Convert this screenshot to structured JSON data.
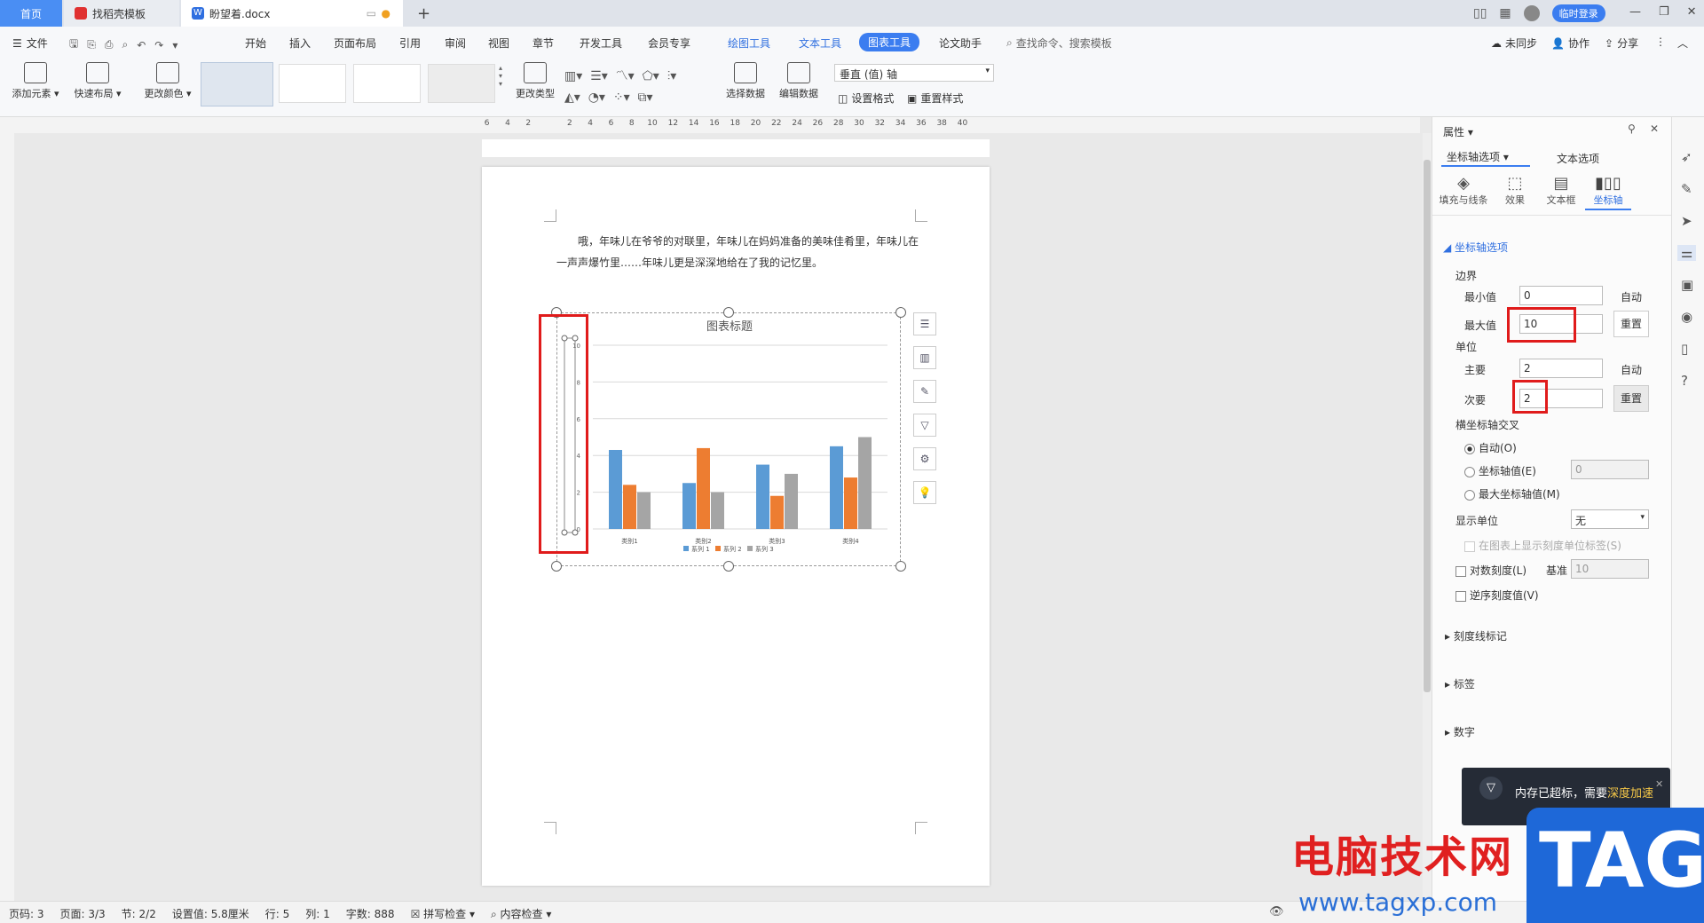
{
  "titlebar": {
    "tabs": [
      {
        "label": "首页"
      },
      {
        "label": "找稻壳模板"
      },
      {
        "label": "盼望着.docx"
      }
    ],
    "login_label": "临时登录"
  },
  "menu": {
    "file_label": "文件",
    "tabs": [
      "开始",
      "插入",
      "页面布局",
      "引用",
      "审阅",
      "视图",
      "章节",
      "开发工具",
      "会员专享",
      "绘图工具",
      "文本工具",
      "图表工具",
      "论文助手"
    ],
    "active_tab": "图表工具",
    "search_placeholder": "查找命令、搜索模板",
    "sync_label": "未同步",
    "collab_label": "协作",
    "share_label": "分享"
  },
  "ribbon": {
    "add_element": "添加元素",
    "quick_layout": "快速布局",
    "change_color": "更改颜色",
    "change_type": "更改类型",
    "select_data": "选择数据",
    "edit_data": "编辑数据",
    "axis_select": "垂直 (值) 轴",
    "set_format": "设置格式",
    "reset_style": "重置样式"
  },
  "ruler": [
    "6",
    "4",
    "2",
    "",
    "2",
    "4",
    "6",
    "8",
    "10",
    "12",
    "14",
    "16",
    "18",
    "20",
    "22",
    "24",
    "26",
    "28",
    "30",
    "32",
    "34",
    "36",
    "38",
    "40"
  ],
  "document": {
    "paragraph_line1": "哦，年味儿在爷爷的对联里，年味儿在妈妈准备的美味佳肴里，年味儿在",
    "paragraph_line2": "一声声爆竹里……年味儿更是深深地给在了我的记忆里。"
  },
  "chart_data": {
    "type": "bar",
    "title": "图表标题",
    "categories": [
      "类别1",
      "类别2",
      "类别3",
      "类别4"
    ],
    "series": [
      {
        "name": "系列 1",
        "values": [
          4.3,
          2.5,
          3.5,
          4.5
        ],
        "color": "#5b9bd5"
      },
      {
        "name": "系列 2",
        "values": [
          2.4,
          4.4,
          1.8,
          2.8
        ],
        "color": "#ed7d31"
      },
      {
        "name": "系列 3",
        "values": [
          2,
          2,
          3,
          5
        ],
        "color": "#a5a5a5"
      }
    ],
    "yticks": [
      "0",
      "2",
      "4",
      "6",
      "8",
      "10"
    ],
    "ylim": [
      0,
      10
    ],
    "legend_position": "bottom",
    "grid": true
  },
  "panel": {
    "title": "属性",
    "tab_axis_options": "坐标轴选项",
    "tab_text_options": "文本选项",
    "subtabs": [
      "填充与线条",
      "效果",
      "文本框",
      "坐标轴"
    ],
    "section_axis_options": "坐标轴选项",
    "bounds_label": "边界",
    "min_label": "最小值",
    "min_value": "0",
    "min_auto": "自动",
    "max_label": "最大值",
    "max_value": "10",
    "reset_label": "重置",
    "units_label": "单位",
    "major_label": "主要",
    "major_value": "2",
    "major_auto": "自动",
    "minor_label": "次要",
    "minor_value": "2",
    "cross_label": "横坐标轴交叉",
    "radio_auto": "自动(O)",
    "radio_axis_value": "坐标轴值(E)",
    "axis_value": "0",
    "radio_max": "最大坐标轴值(M)",
    "display_units_label": "显示单位",
    "display_units_value": "无",
    "show_units_label": "在图表上显示刻度单位标签(S)",
    "log_scale_label": "对数刻度(L)",
    "base_label": "基准",
    "base_value": "10",
    "reverse_label": "逆序刻度值(V)",
    "tick_marks": "刻度线标记",
    "labels": "标签",
    "number": "数字"
  },
  "notification": {
    "text": "内存已超标，需要",
    "link": "深度加速"
  },
  "status": {
    "page_num": "页码: 3",
    "page": "页面: 3/3",
    "section": "节: 2/2",
    "setting": "设置值: 5.8厘米",
    "row": "行: 5",
    "col": "列: 1",
    "words": "字数: 888",
    "spell": "拼写检查",
    "content_check": "内容检查"
  },
  "watermark": {
    "site_name": "电脑技术网",
    "url": "www.tagxp.com",
    "tag": "TAG"
  }
}
